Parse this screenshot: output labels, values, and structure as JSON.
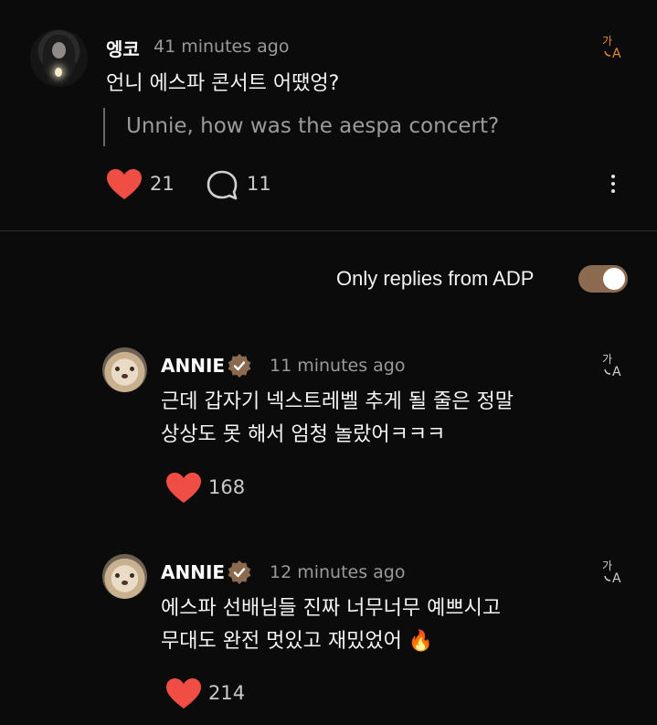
{
  "post": {
    "username": "엥코",
    "time": "41 minutes ago",
    "text": "언니 에스파 콘서트 어땠엉?",
    "translation": "Unnie, how was the aespa concert?",
    "likes": "21",
    "comments": "11"
  },
  "filter": {
    "label": "Only replies from ADP",
    "enabled": true
  },
  "replies": [
    {
      "username": "ANNIE",
      "time": "11 minutes ago",
      "line1": "근데 갑자기 넥스트레벨 추게 될 줄은 정말",
      "line2": "상상도 못 해서 엄청 놀랐어ㅋㅋㅋ",
      "likes": "168"
    },
    {
      "username": "ANNIE",
      "time": "12 minutes ago",
      "line1": "에스파 선배님들 진짜 너무너무 예쁘시고",
      "line2": "무대도 완전 멋있고 재밌었어 🔥",
      "likes": "214"
    }
  ],
  "icons": {
    "translate": "translate-icon",
    "heart": "heart-icon",
    "comment": "comment-icon",
    "more": "more-icon",
    "verified": "verified-icon"
  },
  "colors": {
    "heart": "#f04e45",
    "accent": "#8b6a4f",
    "translate": "#e58a2c"
  }
}
